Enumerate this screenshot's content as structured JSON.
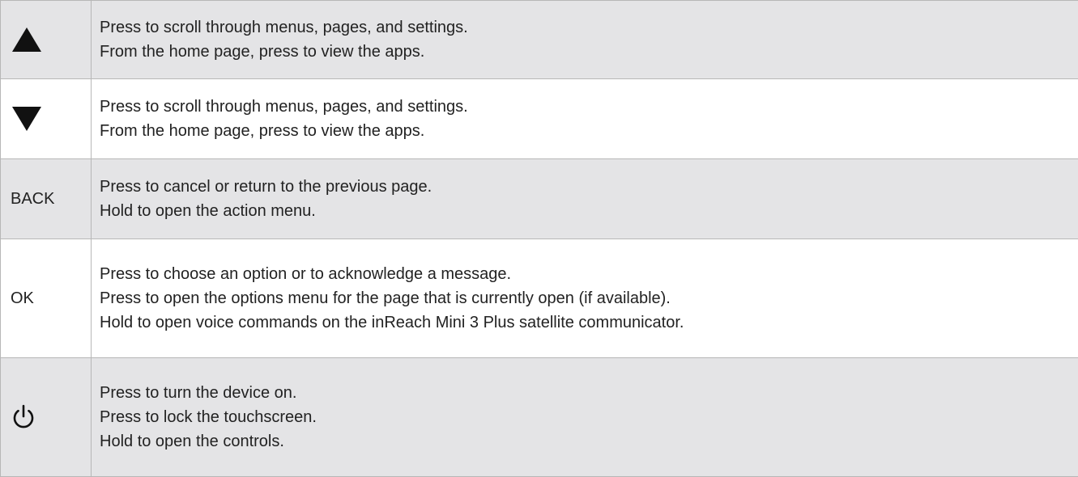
{
  "rows": [
    {
      "key_icon": "triangle-up-icon",
      "lines": [
        "Press to scroll through menus, pages, and settings.",
        "From the home page, press to view the apps."
      ]
    },
    {
      "key_icon": "triangle-down-icon",
      "lines": [
        "Press to scroll through menus, pages, and settings.",
        "From the home page, press to view the apps."
      ]
    },
    {
      "key": "BACK",
      "lines": [
        "Press to cancel or return to the previous page.",
        "Hold to open the action menu."
      ]
    },
    {
      "key": "OK",
      "lines": [
        "Press to choose an option or to acknowledge a message.",
        "Press to open the options menu for the page that is currently open (if available).",
        "Hold to open voice commands on the inReach Mini 3 Plus satellite communicator."
      ]
    },
    {
      "key_icon": "power-icon",
      "lines": [
        "Press to turn the device on.",
        "Press to lock the touchscreen.",
        "Hold to open the controls."
      ]
    }
  ],
  "colors": {
    "row_shaded": "#e4e4e6",
    "row_plain": "#ffffff",
    "border": "#b7b7b7",
    "icon": "#111111"
  }
}
